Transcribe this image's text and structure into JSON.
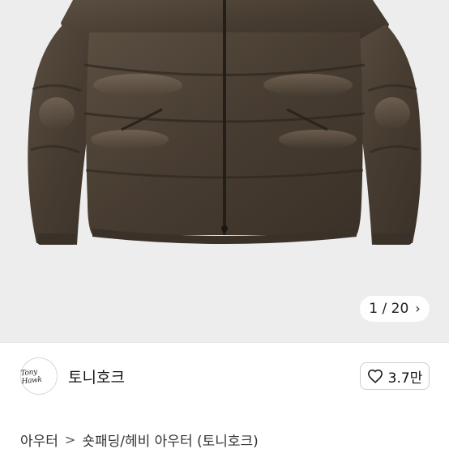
{
  "gallery": {
    "image_alt": "brown short puffer down jacket",
    "page_current": "1",
    "page_separator": "/",
    "page_total": "20",
    "next_icon": "chevron-right-icon"
  },
  "seller": {
    "logo_text": "Tony Hawk",
    "name": "토니호크",
    "like_icon": "heart-outline-icon",
    "like_count": "3.7만"
  },
  "breadcrumb": {
    "category": "아우터",
    "separator": ">",
    "subcategory": "숏패딩/헤비 아우터 (토니호크)"
  },
  "colors": {
    "jacket": "#4a3f33",
    "background": "#ededed",
    "border": "#cfcfcf"
  }
}
